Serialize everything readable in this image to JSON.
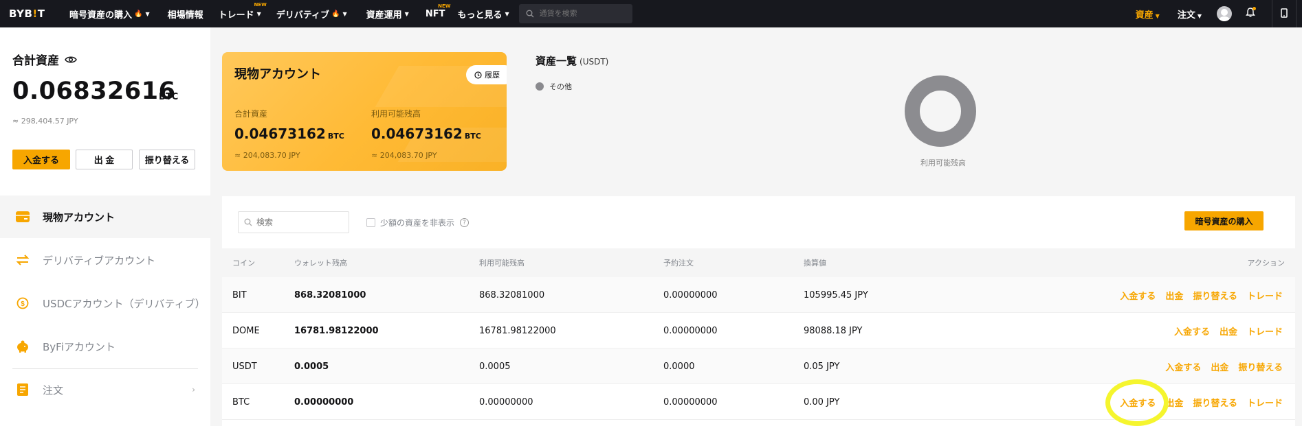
{
  "nav": {
    "logo_a": "BYB",
    "logo_b": "!",
    "logo_c": "T",
    "items": [
      {
        "label": "暗号資産の購入",
        "flame": true,
        "caret": true,
        "new": false
      },
      {
        "label": "相場情報",
        "flame": false,
        "caret": false,
        "new": false
      },
      {
        "label": "トレード",
        "flame": false,
        "caret": true,
        "new": true
      },
      {
        "label": "デリバティブ",
        "flame": true,
        "caret": true,
        "new": false
      },
      {
        "label": "資産運用",
        "flame": false,
        "caret": true,
        "new": false
      },
      {
        "label": "NFT",
        "flame": false,
        "caret": false,
        "new": true
      },
      {
        "label": "もっと見る",
        "flame": false,
        "caret": true,
        "new": false
      }
    ],
    "new_badge": "NEW",
    "search_placeholder": "通貨を検索",
    "assets": "資産",
    "orders": "注文"
  },
  "summary": {
    "title": "合計資産",
    "value": "0.06832616",
    "unit": "BTC",
    "jpy": "≈ 298,404.57 JPY",
    "deposit": "入金する",
    "withdraw": "出 金",
    "transfer": "振り替える"
  },
  "accounts": [
    {
      "label": "現物アカウント",
      "active": true
    },
    {
      "label": "デリバティブアカウント",
      "active": false
    },
    {
      "label": "USDCアカウント（デリバティブ）",
      "active": false
    },
    {
      "label": "ByFiアカウント",
      "active": false
    },
    {
      "label": "注文",
      "active": false
    }
  ],
  "spot": {
    "title": "現物アカウント",
    "history": "履歴",
    "total_label": "合計資産",
    "total_value": "0.04673162",
    "total_unit": "BTC",
    "total_jpy": "≈ 204,083.70 JPY",
    "avail_label": "利用可能残高",
    "avail_value": "0.04673162",
    "avail_unit": "BTC",
    "avail_jpy": "≈ 204,083.70 JPY"
  },
  "overview": {
    "title": "資産一覧",
    "unit": "(USDT)",
    "legend": "その他",
    "donut_label": "利用可能残高",
    "donut_color": "#8c8c90"
  },
  "table": {
    "search_placeholder": "検索",
    "hide_small": "少額の資産を非表示",
    "buy_button": "暗号資産の購入",
    "headers": [
      "コイン",
      "ウォレット残高",
      "利用可能残高",
      "予約注文",
      "換算値",
      "アクション"
    ],
    "rows": [
      {
        "coin": "BIT",
        "wallet": "868.32081000",
        "available": "868.32081000",
        "reserved": "0.00000000",
        "value": "105995.45 JPY",
        "actions": [
          "入金する",
          "出金",
          "振り替える",
          "トレード"
        ]
      },
      {
        "coin": "DOME",
        "wallet": "16781.98122000",
        "available": "16781.98122000",
        "reserved": "0.00000000",
        "value": "98088.18 JPY",
        "actions": [
          "入金する",
          "出金",
          "トレード"
        ]
      },
      {
        "coin": "USDT",
        "wallet": "0.0005",
        "available": "0.0005",
        "reserved": "0.0000",
        "value": "0.05 JPY",
        "actions": [
          "入金する",
          "出金",
          "振り替える"
        ]
      },
      {
        "coin": "BTC",
        "wallet": "0.00000000",
        "available": "0.00000000",
        "reserved": "0.00000000",
        "value": "0.00 JPY",
        "actions": [
          "入金する",
          "出金",
          "振り替える",
          "トレード"
        ]
      }
    ]
  },
  "colors": {
    "accent": "#f7a600",
    "nav_bg": "#17181e",
    "highlight": "#f5f52e"
  }
}
